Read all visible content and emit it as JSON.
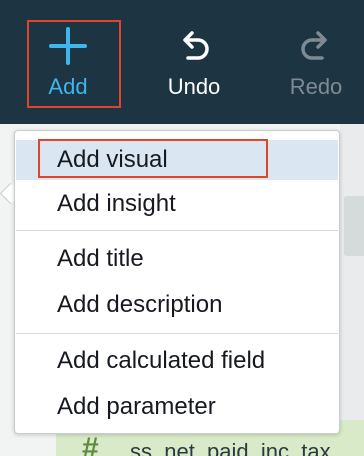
{
  "toolbar": {
    "add_label": "Add",
    "undo_label": "Undo",
    "redo_label": "Redo",
    "add_icon": "plus-icon",
    "undo_icon": "undo-icon",
    "redo_icon": "redo-icon"
  },
  "menu": {
    "groups": [
      [
        "Add visual",
        "Add insight"
      ],
      [
        "Add title",
        "Add description"
      ],
      [
        "Add calculated field",
        "Add parameter"
      ]
    ],
    "items": [
      {
        "label": "Add visual",
        "selected": true
      },
      {
        "label": "Add insight"
      },
      {
        "label": "Add title"
      },
      {
        "label": "Add description"
      },
      {
        "label": "Add calculated field"
      },
      {
        "label": "Add parameter"
      }
    ]
  },
  "background": {
    "field_icon": "hash-icon",
    "field_icon_glyph": "#",
    "field_name": "ss_net_paid_inc_tax"
  },
  "colors": {
    "toolbar_bg": "#1d3442",
    "accent": "#3fb6ec",
    "highlight_border": "#e0442b",
    "selected_item_bg": "#dae7f2",
    "field_row_bg": "#d8eac8"
  }
}
